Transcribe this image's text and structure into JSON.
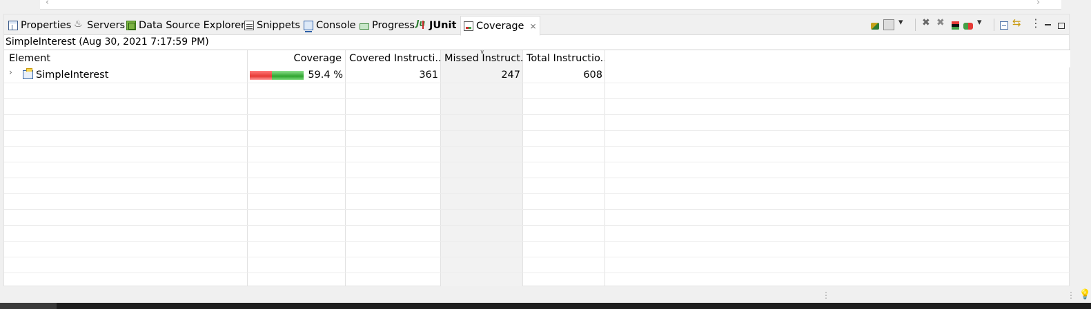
{
  "tabs": [
    {
      "label": "Properties",
      "icon": "properties-icon",
      "bold": false
    },
    {
      "label": "Servers",
      "icon": "servers-icon",
      "bold": false
    },
    {
      "label": "Data Source Explorer",
      "icon": "data-source-explorer-icon",
      "bold": false
    },
    {
      "label": "Snippets",
      "icon": "snippets-icon",
      "bold": false
    },
    {
      "label": "Console",
      "icon": "console-icon",
      "bold": false
    },
    {
      "label": "Progress",
      "icon": "progress-icon",
      "bold": false
    },
    {
      "label": "JUnit",
      "icon": "junit-icon",
      "bold": true
    },
    {
      "label": "Coverage",
      "icon": "coverage-icon",
      "bold": false,
      "active": true,
      "closable": true
    }
  ],
  "session": {
    "title": "SimpleInterest (Aug 30, 2021 7:17:59 PM)"
  },
  "table": {
    "columns": [
      "Element",
      "Coverage",
      "Covered Instructi...",
      "Missed Instruct...",
      "Total Instructio..."
    ],
    "sorted_column": "Missed Instruct...",
    "rows": [
      {
        "element": "SimpleInterest",
        "coverage": "59.4 %",
        "coverage_fraction": 0.594,
        "covered": "361",
        "missed": "247",
        "total": "608"
      }
    ]
  },
  "colors": {
    "covered": "#2fa52f",
    "missed": "#e53935"
  }
}
